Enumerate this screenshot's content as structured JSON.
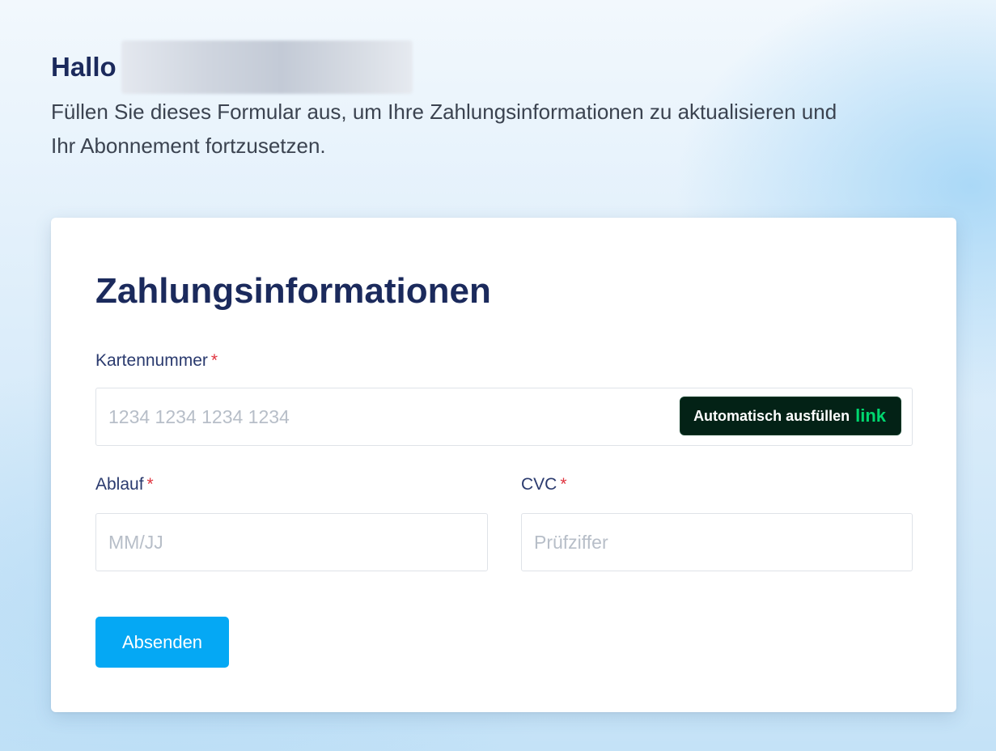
{
  "header": {
    "greeting": "Hallo",
    "intro_text": "Füllen Sie dieses Formular aus, um Ihre Zahlungsinformationen zu aktualisieren und Ihr Abonnement fortzusetzen."
  },
  "form": {
    "title": "Zahlungsinformationen",
    "required_marker": "*",
    "card_number": {
      "label": "Kartennummer",
      "placeholder": "1234 1234 1234 1234"
    },
    "autofill": {
      "label": "Automatisch ausfüllen",
      "brand": "link"
    },
    "expiry": {
      "label": "Ablauf",
      "placeholder": "MM/JJ"
    },
    "cvc": {
      "label": "CVC",
      "placeholder": "Prüfziffer"
    },
    "submit_label": "Absenden"
  },
  "colors": {
    "heading": "#1b2a5c",
    "required": "#e0343f",
    "submit_button": "#05a8f4",
    "autofill_bg": "#032216",
    "autofill_brand": "#00d66f"
  }
}
